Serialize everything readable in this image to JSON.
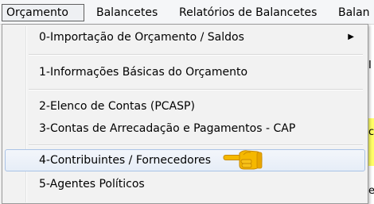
{
  "menubar": {
    "items": [
      {
        "label": "Orçamento"
      },
      {
        "label": "Balancetes"
      },
      {
        "label": "Relatórios de Balancetes"
      },
      {
        "label": "Balan"
      }
    ]
  },
  "dropdown": {
    "items": [
      {
        "label": "0-Importação de Orçamento / Saldos",
        "submenu_icon": "chevron-right-icon"
      },
      {
        "label": "1-Informações Básicas do Orçamento"
      },
      {
        "label": "2-Elenco de Contas (PCASP)"
      },
      {
        "label": "3-Contas de Arrecadação e Pagamentos - CAP"
      },
      {
        "label": "4-Contribuintes / Fornecedores",
        "highlighted": true
      },
      {
        "label": "5-Agentes Políticos"
      }
    ]
  },
  "background_glyphs": [
    "I",
    "c",
    "e"
  ],
  "colors": {
    "highlight_border": "#aac3e6",
    "pointer_hand": "#f5b800",
    "background_strip": "#ffff66"
  },
  "pointer": {
    "icon": "pointing-hand-icon"
  }
}
